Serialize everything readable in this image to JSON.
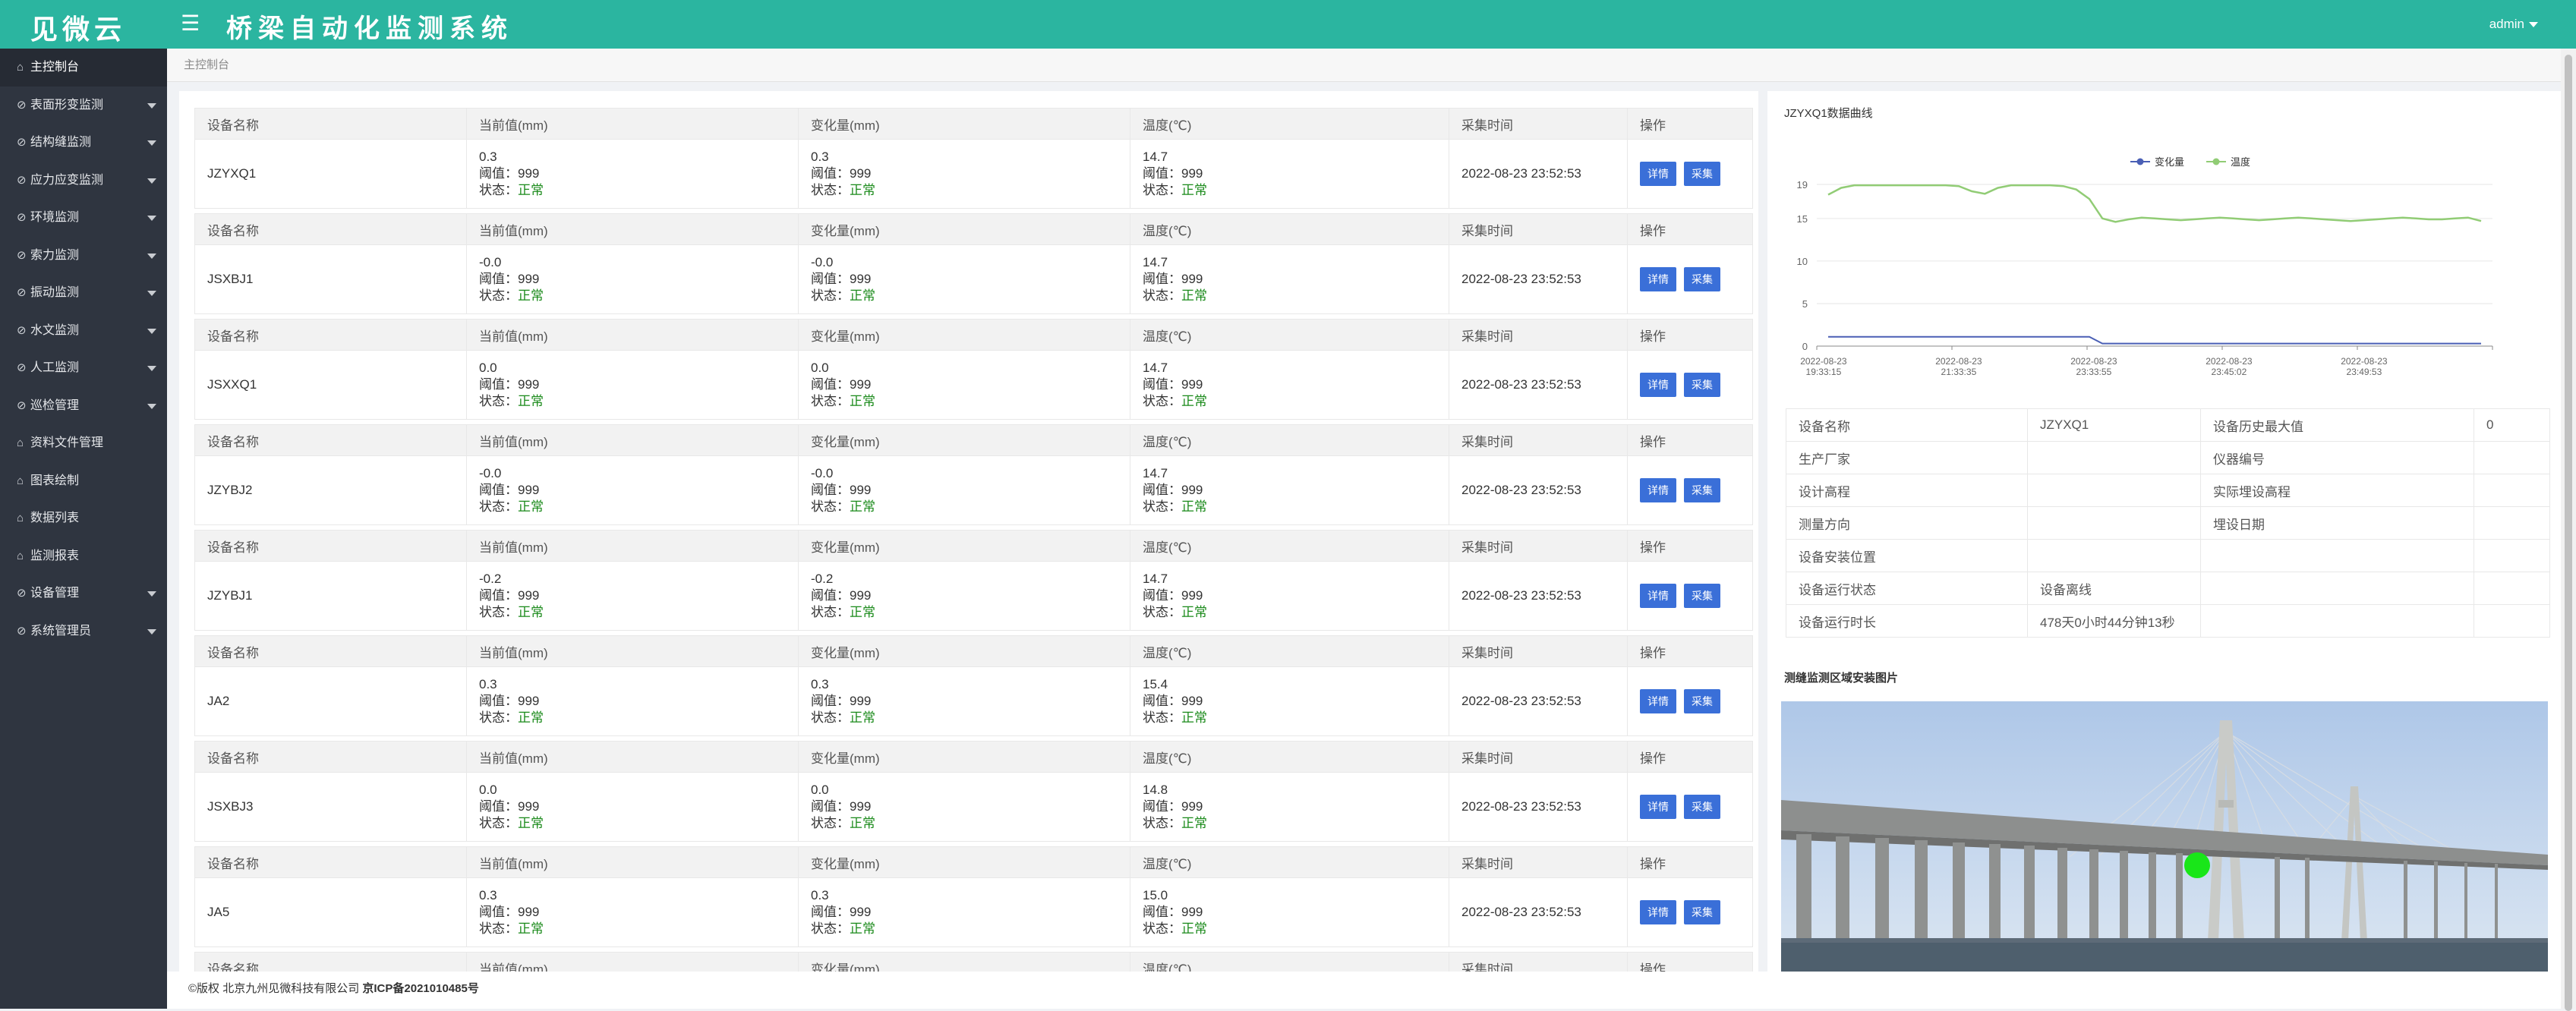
{
  "header": {
    "logo": "见微云",
    "title": "桥梁自动化监测系统",
    "user": "admin"
  },
  "sidebar": {
    "items": [
      {
        "label": "主控制台",
        "icon": "home-icon",
        "arrow": false,
        "active": true
      },
      {
        "label": "表面形变监测",
        "icon": "circle-check-icon",
        "arrow": true
      },
      {
        "label": "结构缝监测",
        "icon": "circle-check-icon",
        "arrow": true
      },
      {
        "label": "应力应变监测",
        "icon": "circle-check-icon",
        "arrow": true
      },
      {
        "label": "环境监测",
        "icon": "circle-check-icon",
        "arrow": true
      },
      {
        "label": "索力监测",
        "icon": "circle-check-icon",
        "arrow": true
      },
      {
        "label": "振动监测",
        "icon": "circle-check-icon",
        "arrow": true
      },
      {
        "label": "水文监测",
        "icon": "circle-check-icon",
        "arrow": true
      },
      {
        "label": "人工监测",
        "icon": "circle-check-icon",
        "arrow": true
      },
      {
        "label": "巡检管理",
        "icon": "circle-check-icon",
        "arrow": true
      },
      {
        "label": "资料文件管理",
        "icon": "home-icon",
        "arrow": false
      },
      {
        "label": "图表绘制",
        "icon": "home-icon",
        "arrow": false
      },
      {
        "label": "数据列表",
        "icon": "home-icon",
        "arrow": false
      },
      {
        "label": "监测报表",
        "icon": "home-icon",
        "arrow": false
      },
      {
        "label": "设备管理",
        "icon": "circle-check-icon",
        "arrow": true
      },
      {
        "label": "系统管理员",
        "icon": "circle-check-icon",
        "arrow": true
      }
    ]
  },
  "breadcrumb": "主控制台",
  "table": {
    "headers": [
      "设备名称",
      "当前值(mm)",
      "变化量(mm)",
      "温度(℃)",
      "采集时间",
      "操作"
    ],
    "threshold_label": "阈值：",
    "status_label": "状态：",
    "detail_label": "详情",
    "collect_label": "采集",
    "rows": [
      {
        "name": "JZYXQ1",
        "current": "0.3",
        "change": "0.3",
        "temp": "14.7",
        "threshold": "999",
        "status": "正常",
        "time": "2022-08-23 23:52:53"
      },
      {
        "name": "JSXBJ1",
        "current": "-0.0",
        "change": "-0.0",
        "temp": "14.7",
        "threshold": "999",
        "status": "正常",
        "time": "2022-08-23 23:52:53"
      },
      {
        "name": "JSXXQ1",
        "current": "0.0",
        "change": "0.0",
        "temp": "14.7",
        "threshold": "999",
        "status": "正常",
        "time": "2022-08-23 23:52:53"
      },
      {
        "name": "JZYBJ2",
        "current": "-0.0",
        "change": "-0.0",
        "temp": "14.7",
        "threshold": "999",
        "status": "正常",
        "time": "2022-08-23 23:52:53"
      },
      {
        "name": "JZYBJ1",
        "current": "-0.2",
        "change": "-0.2",
        "temp": "14.7",
        "threshold": "999",
        "status": "正常",
        "time": "2022-08-23 23:52:53"
      },
      {
        "name": "JA2",
        "current": "0.3",
        "change": "0.3",
        "temp": "15.4",
        "threshold": "999",
        "status": "正常",
        "time": "2022-08-23 23:52:53"
      },
      {
        "name": "JSXBJ3",
        "current": "0.0",
        "change": "0.0",
        "temp": "14.8",
        "threshold": "999",
        "status": "正常",
        "time": "2022-08-23 23:52:53"
      },
      {
        "name": "JA5",
        "current": "0.3",
        "change": "0.3",
        "temp": "15.0",
        "threshold": "999",
        "status": "正常",
        "time": "2022-08-23 23:52:53"
      }
    ]
  },
  "chart_data": {
    "type": "line",
    "title": "JZYXQ1数据曲线",
    "legend": "top-center",
    "x_tick_labels": [
      [
        "2022-08-23",
        "19:33:15"
      ],
      [
        "2022-08-23",
        "21:33:35"
      ],
      [
        "2022-08-23",
        "23:33:55"
      ],
      [
        "2022-08-23",
        "23:45:02"
      ],
      [
        "2022-08-23",
        "23:49:53"
      ]
    ],
    "y_ticks": [
      0,
      5,
      10,
      15,
      19
    ],
    "ylim": [
      0,
      19
    ],
    "grid": true,
    "series": [
      {
        "name": "变化量",
        "color": "#4a5fb5",
        "values": [
          1.1,
          1.1,
          1.1,
          1.1,
          1.1,
          1.1,
          1.1,
          1.1,
          1.1,
          1.1,
          1.1,
          1.1,
          1.1,
          1.1,
          1.1,
          1.1,
          1.1,
          1.1,
          1.1,
          1.1,
          1.1,
          0.3,
          0.3,
          0.3,
          0.3,
          0.3,
          0.3,
          0.3,
          0.3,
          0.3,
          0.3,
          0.3,
          0.3,
          0.3,
          0.3,
          0.3,
          0.3,
          0.3,
          0.3,
          0.3,
          0.3,
          0.3,
          0.3,
          0.3,
          0.3,
          0.3,
          0.3,
          0.3,
          0.3,
          0.3,
          0.3
        ]
      },
      {
        "name": "温度",
        "color": "#91cc75",
        "values": [
          17.8,
          18.6,
          18.9,
          18.9,
          18.9,
          18.9,
          18.9,
          18.9,
          18.9,
          18.9,
          18.8,
          18.2,
          17.9,
          18.6,
          18.9,
          18.9,
          18.9,
          18.9,
          18.8,
          18.4,
          17.3,
          15.0,
          14.6,
          14.9,
          15.1,
          15.0,
          14.9,
          14.8,
          14.9,
          15.0,
          15.1,
          15.0,
          14.9,
          14.8,
          14.9,
          15.0,
          15.1,
          15.0,
          14.9,
          14.8,
          14.7,
          14.8,
          14.9,
          15.0,
          15.1,
          15.0,
          14.9,
          14.9,
          15.0,
          15.1,
          14.7
        ]
      }
    ]
  },
  "info": {
    "rows": [
      [
        "设备名称",
        "JZYXQ1",
        "设备历史最大值",
        "0"
      ],
      [
        "生产厂家",
        "",
        "仪器编号",
        ""
      ],
      [
        "设计高程",
        "",
        "实际埋设高程",
        ""
      ],
      [
        "测量方向",
        "",
        "埋设日期",
        ""
      ],
      [
        "设备安装位置",
        "",
        "",
        ""
      ],
      [
        "设备运行状态",
        "设备离线",
        "",
        ""
      ],
      [
        "设备运行时长",
        "478天0小时44分钟13秒",
        "",
        ""
      ]
    ]
  },
  "image_title": "测缝监测区域安装图片",
  "footer": {
    "copyright": "©版权 北京九州见微科技有限公司 ",
    "icp": "京ICP备2021010485号"
  }
}
